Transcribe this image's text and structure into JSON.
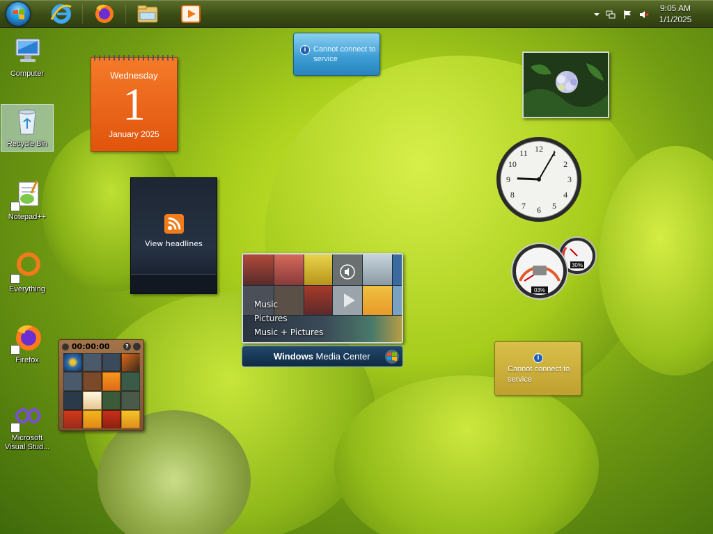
{
  "taskbar": {
    "pinned": [
      {
        "name": "start-button"
      },
      {
        "name": "internet-explorer"
      },
      {
        "name": "firefox"
      },
      {
        "name": "file-explorer"
      },
      {
        "name": "media-player"
      }
    ],
    "clock": {
      "time": "9:05 AM",
      "date": "1/1/2025"
    }
  },
  "desktop_icons": [
    {
      "label": "Computer",
      "icon": "computer-icon"
    },
    {
      "label": "Recycle Bin",
      "icon": "recycle-bin-icon"
    },
    {
      "label": "Notepad++",
      "icon": "notepad-plus-plus-icon"
    },
    {
      "label": "Everything",
      "icon": "everything-search-icon"
    },
    {
      "label": "Firefox",
      "icon": "firefox-icon"
    },
    {
      "label": "Microsoft Visual Stud...",
      "icon": "visual-studio-icon"
    }
  ],
  "gadgets": {
    "calendar": {
      "weekday": "Wednesday",
      "day": "1",
      "month_year": "January 2025"
    },
    "feed": {
      "label": "View headlines"
    },
    "service_top": {
      "message": "Cannot connect to service"
    },
    "service_weather": {
      "message": "Cannot connect to service"
    },
    "clock": {
      "hour": 9,
      "minute": 5,
      "numerals": [
        "12",
        "1",
        "2",
        "3",
        "4",
        "5",
        "6",
        "7",
        "8",
        "9",
        "10",
        "11"
      ]
    },
    "cpu_meter": {
      "cpu": "03%",
      "memory": "30%"
    },
    "media_center": {
      "menu": [
        "Music",
        "Pictures",
        "Music + Pictures"
      ],
      "title_bold": "Windows",
      "title_rest": " Media Center"
    },
    "puzzle": {
      "timer": "00:00:00"
    }
  }
}
